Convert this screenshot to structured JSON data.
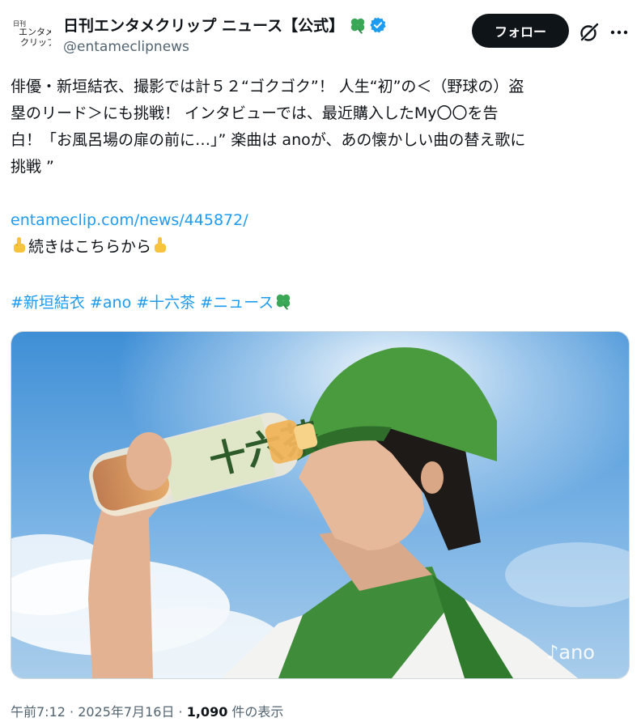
{
  "account": {
    "avatar_text_line1": "日刊",
    "avatar_text_line2": "エンタメ",
    "avatar_text_line3": "クリップ",
    "display_name": "日刊エンタメクリップ ニュース【公式】",
    "handle": "@entameclipnews",
    "verified_icon": "verified-badge-icon",
    "name_emoji": "four-leaf-clover"
  },
  "actions": {
    "follow_label": "フォロー",
    "grok_icon": "grok-icon",
    "more_icon": "more-icon"
  },
  "tweet": {
    "lines": [
      "俳優・新垣結衣、撮影では計５２“ゴクゴク”！ 人生“初”の＜（野球の）盗",
      "塁のリード＞にも挑戦！ インタビューでは、最近購入したMy〇〇を告",
      "白！「お風呂場の扉の前に…」” 楽曲は anoが、あの懐かしい曲の替え歌に",
      "挑戦 ”"
    ],
    "link": "entameclip.com/news/445872/",
    "continue_text": "続きはこちらから",
    "hashtags": [
      "#新垣結衣",
      "#ano",
      "#十六茶",
      "#ニュース"
    ]
  },
  "media": {
    "watermark": "ano",
    "bottle_label": "十六茶"
  },
  "meta": {
    "time": "午前7:12 · 2025年7月16日 · ",
    "views_count": "1,090",
    "views_label": " 件の表示"
  },
  "colors": {
    "link": "#1d9bf0",
    "follow_bg": "#0f1419",
    "verified": "#1d9bf0"
  }
}
